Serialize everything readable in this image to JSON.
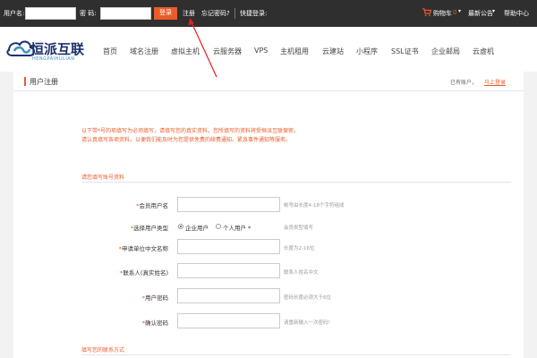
{
  "topbar": {
    "username_label": "用户名:",
    "password_label": "密  码:",
    "login_button": "登录",
    "register_link": "注册",
    "forgot_link": "忘记密码?",
    "quick_login": "快捷登录:",
    "cart_label": "购物车",
    "cart_count": "0",
    "announcement": "最新公告",
    "help": "帮助中心"
  },
  "brand": {
    "name": "恒派互联",
    "sub": "HENGPAIHULIAN",
    "colors": {
      "primary": "#1c2f6e",
      "accent": "#e85c2a",
      "cloud": "#3a8fc8"
    }
  },
  "nav": [
    "首页",
    "域名注册",
    "虚拟主机",
    "云服务器",
    "VPS",
    "主机租用",
    "云建站",
    "小程序",
    "SSL证书",
    "企业邮局",
    "云虚机"
  ],
  "page": {
    "title": "用户注册",
    "has_account": "已有账户，",
    "login_link": "马上登录",
    "notice_1": "以下带*号的项填写为必须填写，请填写您的真实资料，您所填写的资料将受恒派互联保密。",
    "notice_2": "请认真填写各项资料，以便我们能及时为您提供免费的续费通知、紧急事件通知等服务。",
    "section_account": "请您填写账号资料",
    "section_contact": "填写您的联系方式"
  },
  "form": {
    "username": {
      "label": "会员用户名",
      "hint": "帐号由长度4-18个字符组成"
    },
    "user_type": {
      "label": "选择用户类型",
      "options": [
        "企业用户",
        "个人用户 *"
      ],
      "hint": "会员类型填写"
    },
    "company": {
      "label": "申请单位中文名称",
      "hint": "长度为2-16位"
    },
    "contact": {
      "label": "联系人(真实姓名)",
      "hint": "联系人姓名中文"
    },
    "password": {
      "label": "用户密码",
      "hint": "密码长度必须大于6位"
    },
    "confirm": {
      "label": "确认密码",
      "hint": "请重新输入一次密码！"
    }
  }
}
